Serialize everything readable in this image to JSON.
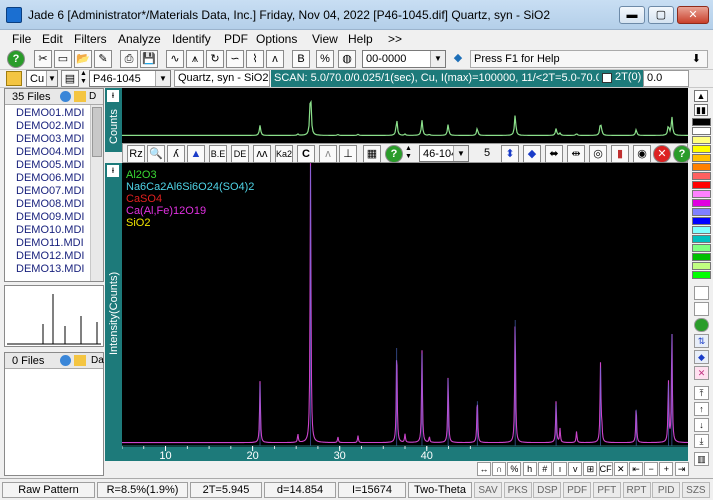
{
  "window": {
    "title": "Jade 6 [Administrator*/Materials Data, Inc.] Friday, Nov 04, 2022 [P46-1045.dif] Quartz, syn - SiO2",
    "min": "▬",
    "max": "▢",
    "close": "✕"
  },
  "menu": [
    "File",
    "Edit",
    "Filters",
    "Analyze",
    "Identify",
    "PDF",
    "Options",
    "View",
    "Help",
    ">>"
  ],
  "toolbar1": {
    "combo_value": "00-0000",
    "help_text": "Press F1 for Help"
  },
  "toolbar2": {
    "element": "Cu",
    "pdf_card": "P46-1045",
    "phase": "Quartz, syn - SiO2",
    "scan_info": "SCAN: 5.0/70.0/0.025/1(sec), Cu, I(max)=100000, 11/<2T=5.0-70.0>",
    "twotheta_label": "2T(0)",
    "twotheta_value": "0.0"
  },
  "files": {
    "count_label": "35 Files",
    "items": [
      "DEMO01.MDI",
      "DEMO02.MDI",
      "DEMO03.MDI",
      "DEMO04.MDI",
      "DEMO05.MDI",
      "DEMO06.MDI",
      "DEMO07.MDI",
      "DEMO08.MDI",
      "DEMO09.MDI",
      "DEMO10.MDI",
      "DEMO11.MDI",
      "DEMO12.MDI",
      "DEMO13.MDI"
    ]
  },
  "files2": {
    "count_label": "0 Files",
    "col": "Da"
  },
  "side_labels": {
    "counts": "Counts",
    "intensity": "Intensity(Counts)",
    "marker": "ᵻ"
  },
  "plot_toolbar": {
    "tools": [
      "Rz",
      "🔍",
      "ʎ",
      "▲",
      "B.E",
      "DE",
      "ʌʌ",
      "Ka2",
      "C",
      "ʌ",
      "⊥"
    ],
    "pdf_select": "46-104",
    "step": "5"
  },
  "legend": [
    {
      "label": "Al2O3",
      "color": "#39d834"
    },
    {
      "label": "Na6Ca2Al6Si6O24(SO4)2",
      "color": "#4fd3e6"
    },
    {
      "label": "CaSO4",
      "color": "#e02020"
    },
    {
      "label": "Ca(Al,Fe)12O19",
      "color": "#e030e0"
    },
    {
      "label": "SiO2",
      "color": "#f2e600"
    }
  ],
  "chart_data": {
    "type": "line",
    "xlabel": "Two-Theta",
    "ylabel": "Intensity(Counts)",
    "xlim": [
      5,
      70
    ],
    "x_ticks": [
      10,
      20,
      30,
      40
    ],
    "peaks": [
      {
        "x": 20.85,
        "y": 0.22
      },
      {
        "x": 26.65,
        "y": 1.0
      },
      {
        "x": 36.55,
        "y": 0.35
      },
      {
        "x": 39.45,
        "y": 0.33
      },
      {
        "x": 42.45,
        "y": 0.24
      },
      {
        "x": 45.8,
        "y": 0.16
      },
      {
        "x": 50.15,
        "y": 0.45
      },
      {
        "x": 54.85,
        "y": 0.15
      },
      {
        "x": 59.95,
        "y": 0.28
      },
      {
        "x": 64.05,
        "y": 0.13
      },
      {
        "x": 67.75,
        "y": 0.22
      },
      {
        "x": 68.15,
        "y": 0.4
      }
    ],
    "minor_peaks": [
      {
        "x": 25.2,
        "y": 0.03
      },
      {
        "x": 29.8,
        "y": 0.02
      },
      {
        "x": 32.1,
        "y": 0.025
      },
      {
        "x": 37.5,
        "y": 0.03
      },
      {
        "x": 40.3,
        "y": 0.02
      },
      {
        "x": 55.3,
        "y": 0.05
      },
      {
        "x": 57.2,
        "y": 0.04
      },
      {
        "x": 60.1,
        "y": 0.05
      }
    ],
    "line_color": "#cc44cc",
    "overview_color": "#8be08b"
  },
  "statusbar": {
    "pattern": "Raw Pattern",
    "r": "R=8.5%(1.9%)",
    "two_theta": "2T=5.945",
    "d": "d=14.854",
    "i": "I=15674",
    "axis": "Two-Theta",
    "buttons": [
      "SAV",
      "PKS",
      "DSP",
      "PDF",
      "PFT",
      "RPT",
      "PID",
      "SZS"
    ]
  },
  "bottom_tools": [
    "↔",
    "∩",
    "%",
    "h",
    "#",
    "ı",
    "v",
    "⊞",
    "CF",
    "✕",
    "⇤",
    "−",
    "+",
    "⇥"
  ],
  "right_palette": [
    "#000000",
    "#ffffff",
    "#ffff80",
    "#ffff00",
    "#ffc000",
    "#ff8000",
    "#ff6060",
    "#ff0000",
    "#ff80ff",
    "#e000e0",
    "#8080ff",
    "#0000ff",
    "#80ffff",
    "#00c0c0",
    "#80ff80",
    "#00c000",
    "#c0ff80",
    "#00ff00"
  ]
}
